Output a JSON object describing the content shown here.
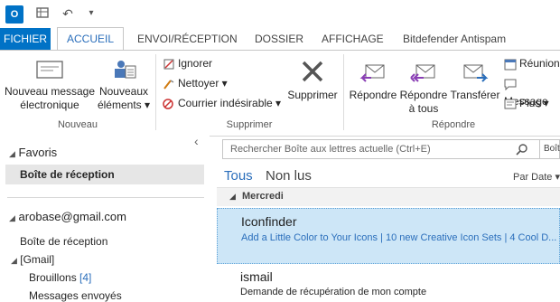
{
  "app": {
    "icon_letter": "O"
  },
  "quick_access": {
    "undo": "↶",
    "dropdown": "▾"
  },
  "tabs": [
    {
      "label": "FICHIER"
    },
    {
      "label": "ACCUEIL"
    },
    {
      "label": "ENVOI/RÉCEPTION"
    },
    {
      "label": "DOSSIER"
    },
    {
      "label": "AFFICHAGE"
    },
    {
      "label": "Bitdefender Antispam"
    }
  ],
  "ribbon": {
    "new_message": [
      "Nouveau message",
      "électronique"
    ],
    "new_items": [
      "Nouveaux",
      "éléments ▾"
    ],
    "group_new": "Nouveau",
    "ignore": "Ignorer",
    "clean": "Nettoyer ▾",
    "junk": "Courrier indésirable ▾",
    "delete": "Supprimer",
    "group_delete": "Supprimer",
    "reply": "Répondre",
    "reply_all": [
      "Répondre",
      "à tous"
    ],
    "forward": "Transférer",
    "meeting": "Réunion",
    "message": "Message",
    "more": "Plus ▾",
    "group_respond": "Répondre"
  },
  "nav": {
    "collapse": "‹",
    "favorites": "Favoris",
    "fav_inbox": "Boîte de réception",
    "account": "arobase@gmail.com",
    "inbox": "Boîte de réception",
    "gmail": "[Gmail]",
    "drafts": "Brouillons",
    "drafts_count": "[4]",
    "sent": "Messages envoyés"
  },
  "main": {
    "search_placeholder": "Rechercher Boîte aux lettres actuelle (Ctrl+E)",
    "current_mailbox": "Boîte aux lettres actuelle ▾",
    "filter_all": "Tous",
    "filter_unread": "Non lus",
    "sort": "Par Date ▾",
    "group_header": "Mercredi",
    "mails": [
      {
        "sender": "Iconfinder",
        "subject": "Add a Little Color to Your Icons | 10 new Creative Icon Sets | 4 Cool D..."
      },
      {
        "sender": "ismail",
        "subject": "Demande de récupération de mon compte"
      }
    ]
  },
  "colors": {
    "accent": "#0072c6",
    "selected": "#cde6f7",
    "selected_border": "#5aa0d6"
  }
}
